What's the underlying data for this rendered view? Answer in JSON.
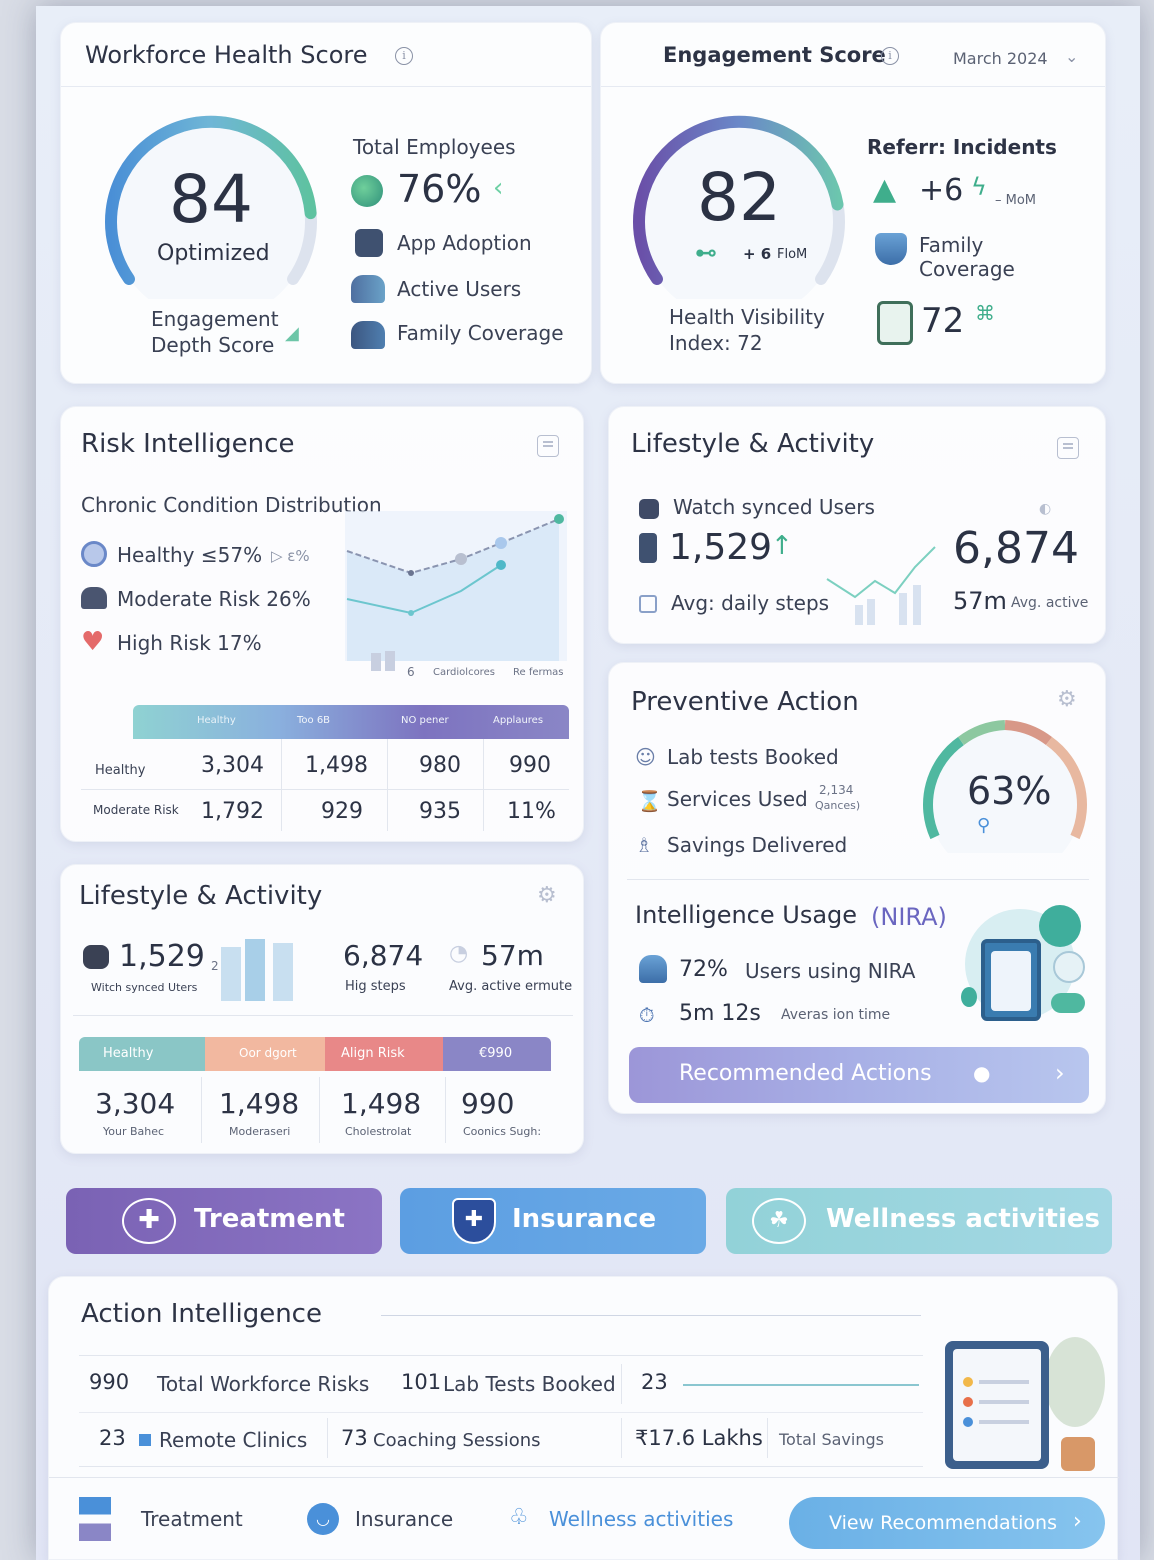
{
  "workforce": {
    "title": "Workforce Health Score",
    "score": "84",
    "score_label": "Optimized",
    "sub_label_1": "Engagement",
    "sub_label_2": "Depth Score",
    "total_employees_label": "Total Employees",
    "pct": "76%",
    "items": [
      "App Adoption",
      "Active Users",
      "Family Coverage"
    ]
  },
  "engagement": {
    "title": "Engagement Score",
    "month": "March 2024",
    "score": "82",
    "delta": "+ 6",
    "delta_unit": "FloM",
    "hvi_line1": "Health Visibility",
    "hvi_line2": "Index: 72",
    "referr_title": "Referr: Incidents",
    "referr_delta": "+6",
    "referr_unit": "– MoM",
    "family_line1": "Family",
    "family_line2": "Coverage",
    "index_value": "72"
  },
  "risk": {
    "title": "Risk Intelligence",
    "subtitle": "Chronic Condition Distribution",
    "items": [
      {
        "label": "Healthy ≤57%",
        "extra": "▷ ε%"
      },
      {
        "label": "Moderate Risk 26%"
      },
      {
        "label": "High Risk 17%"
      }
    ],
    "chart_axis": [
      "6",
      "Cardiolcores",
      "Re fermas"
    ],
    "table_headers": [
      "Healthy",
      "Too 6B",
      "NO pener",
      "Applaures"
    ],
    "rows": [
      {
        "name": "Healthy",
        "values": [
          "3,304",
          "1,498",
          "980",
          "990"
        ]
      },
      {
        "name": "Moderate Risk",
        "values": [
          "1,792",
          "929",
          "935",
          "11%"
        ]
      }
    ]
  },
  "lifestyle_top": {
    "title": "Lifestyle & Activity",
    "watch_label": "Watch synced Users",
    "watch_value": "1,529",
    "steps_label": "Avg: daily steps",
    "big_value": "6,874",
    "active_value": "57m",
    "active_label": "Avg. active"
  },
  "preventive": {
    "title": "Preventive Action",
    "items": [
      "Lab tests Booked",
      "Services Used",
      "Savings Delivered"
    ],
    "services_note_1": "2,134",
    "services_note_2": "Qances)",
    "gauge_value": "63%"
  },
  "nira": {
    "title": "Intelligence Usage",
    "title_accent": "(NIRA)",
    "users_pct": "72%",
    "users_label": "Users using NIRA",
    "session_time": "5m 12s",
    "session_label": "Averas ion time",
    "recommended": "Recommended Actions"
  },
  "lifestyle_bottom": {
    "title": "Lifestyle & Activity",
    "watch_value": "1,529",
    "watch_note": "2 ʻ9",
    "watch_label": "Witch synced Uters",
    "steps_value": "6,874",
    "steps_label": "Hig steps",
    "active_value": "57m",
    "active_label": "Avg. active ermute",
    "headers": [
      "Healthy",
      "Oor dgort",
      "Align Risk",
      "€990"
    ],
    "values": [
      "3,304",
      "1,498",
      "1,498",
      "990"
    ],
    "captions": [
      "Your Bahec",
      "Moderaseri",
      "Cholestrolat",
      "Coonics Sugh:"
    ]
  },
  "tabs": {
    "treatment": "Treatment",
    "insurance": "Insurance",
    "wellness": "Wellness activities"
  },
  "action": {
    "title": "Action Intelligence",
    "r1": {
      "a_num": "990",
      "a_lbl": "Total Workforce Risks",
      "b_num": "101",
      "b_lbl": "Lab Tests Booked",
      "c_num": "23"
    },
    "r2": {
      "a_num": "23",
      "a_lbl": "Remote Clinics",
      "b_num": "73",
      "b_lbl": "Coaching Sessions",
      "c_num": "₹17.6 Lakhs",
      "c_lbl": "Total Savings"
    }
  },
  "footer": {
    "treatment": "Treatment",
    "insurance": "Insurance",
    "wellness": "Wellness activities",
    "cta": "View Recommendations"
  },
  "colors": {
    "purple": "#7b68b8",
    "blue": "#4a90d9",
    "teal": "#8fd0d0",
    "accent_green": "#4fb8a0"
  },
  "gauges": {
    "workforce_fraction": 0.84,
    "engagement_fraction": 0.82,
    "preventive_fraction": 0.63
  }
}
